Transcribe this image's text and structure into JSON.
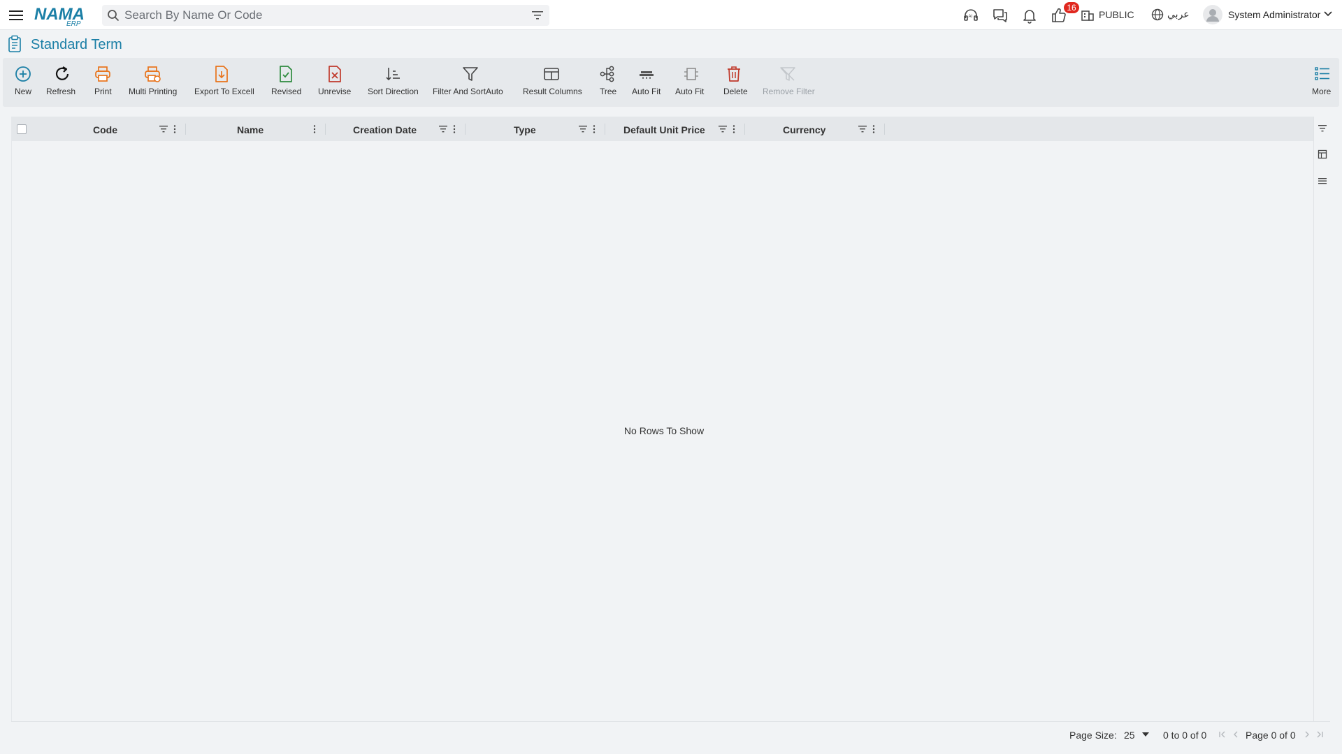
{
  "app": {
    "logo_text": "NAMA",
    "logo_sub": "ERP"
  },
  "search": {
    "placeholder": "Search By Name Or Code"
  },
  "header": {
    "notification_count": "16",
    "branch": "PUBLIC",
    "language": "عربي",
    "user_name": "System Administrator"
  },
  "page": {
    "title": "Standard Term"
  },
  "toolbar": {
    "new": "New",
    "refresh": "Refresh",
    "print": "Print",
    "multi_printing": "Multi Printing",
    "export": "Export To Excell",
    "revised": "Revised",
    "unrevise": "Unrevise",
    "sort_direction": "Sort Direction",
    "filter_sort": "Filter And SortAuto",
    "result_columns": "Result Columns",
    "tree": "Tree",
    "auto_fit_1": "Auto Fit",
    "auto_fit_2": "Auto Fit",
    "delete": "Delete",
    "remove_filter": "Remove Filter",
    "more": "More"
  },
  "grid": {
    "columns": [
      "Code",
      "Name",
      "Creation Date",
      "Type",
      "Default Unit Price",
      "Currency"
    ],
    "empty_message": "No Rows To Show"
  },
  "footer": {
    "page_size_label": "Page Size:",
    "page_size": "25",
    "range": "0 to 0 of 0",
    "page_info": "Page 0 of 0"
  },
  "colors": {
    "accent": "#1b7fa6",
    "badge": "#e0281f",
    "orange": "#e8731a",
    "green": "#2e8b3e",
    "red": "#c0392b"
  }
}
